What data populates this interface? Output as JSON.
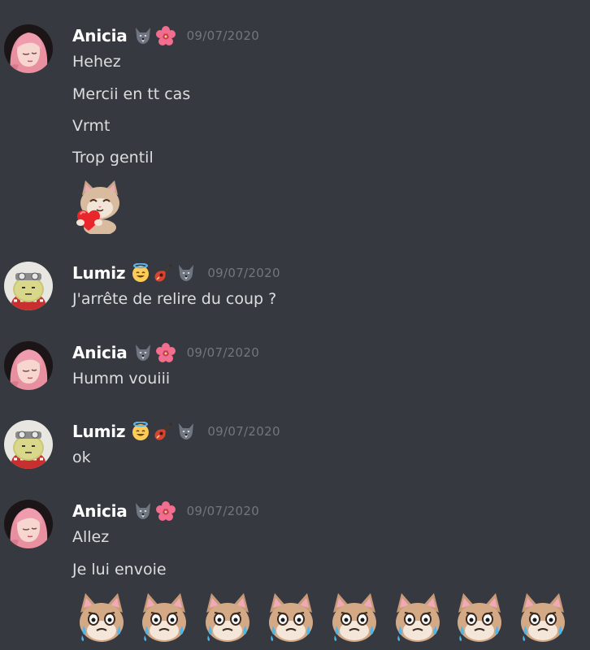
{
  "messages": [
    {
      "author": "Anicia",
      "badges": [
        "wolf-icon",
        "hibiscus-icon"
      ],
      "timestamp": "09/07/2020",
      "lines": [
        "Hehez",
        "Mercii en tt cas",
        "Vrmt",
        "Trop gentil"
      ],
      "stickers": [
        "cat-heart-sticker"
      ]
    },
    {
      "author": "Lumiz",
      "badges": [
        "halo-smile-icon",
        "guitar-icon",
        "wolf-icon"
      ],
      "timestamp": "09/07/2020",
      "lines": [
        "J'arrête de relire du coup ?"
      ]
    },
    {
      "author": "Anicia",
      "badges": [
        "wolf-icon",
        "hibiscus-icon"
      ],
      "timestamp": "09/07/2020",
      "lines": [
        "Humm vouiii"
      ]
    },
    {
      "author": "Lumiz",
      "badges": [
        "halo-smile-icon",
        "guitar-icon",
        "wolf-icon"
      ],
      "timestamp": "09/07/2020",
      "lines": [
        "ok"
      ]
    },
    {
      "author": "Anicia",
      "badges": [
        "wolf-icon",
        "hibiscus-icon"
      ],
      "timestamp": "09/07/2020",
      "lines": [
        "Allez",
        "Je lui envoie"
      ],
      "stickers": [
        "crying-cat-emoji",
        "crying-cat-emoji",
        "crying-cat-emoji",
        "crying-cat-emoji",
        "crying-cat-emoji",
        "crying-cat-emoji",
        "crying-cat-emoji",
        "crying-cat-emoji"
      ]
    }
  ],
  "colors": {
    "background": "#36393f",
    "username": "#ffffff",
    "message_text": "#dcddde",
    "timestamp": "#72767d"
  }
}
